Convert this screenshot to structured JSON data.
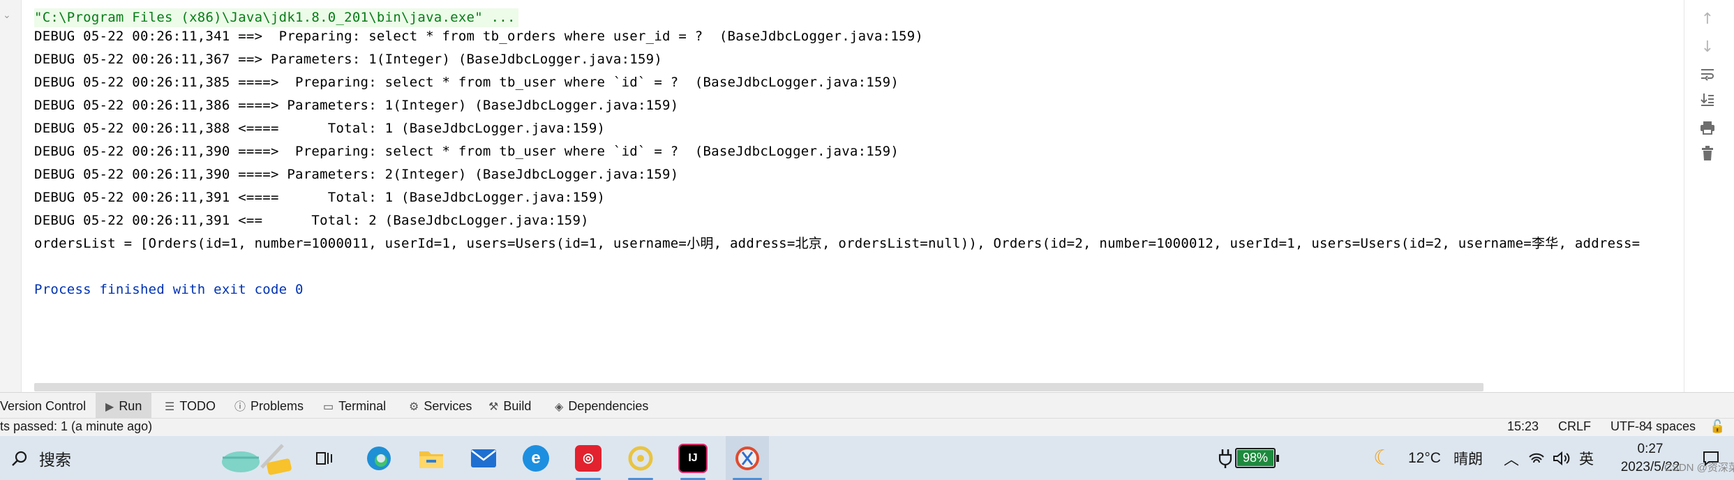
{
  "console": {
    "lines": [
      "\"C:\\Program Files (x86)\\Java\\jdk1.8.0_201\\bin\\java.exe\" ...",
      "DEBUG 05-22 00:26:11,341 ==>  Preparing: select * from tb_orders where user_id = ?  (BaseJdbcLogger.java:159)",
      "DEBUG 05-22 00:26:11,367 ==> Parameters: 1(Integer) (BaseJdbcLogger.java:159)",
      "DEBUG 05-22 00:26:11,385 ====>  Preparing: select * from tb_user where `id` = ?  (BaseJdbcLogger.java:159)",
      "DEBUG 05-22 00:26:11,386 ====> Parameters: 1(Integer) (BaseJdbcLogger.java:159)",
      "DEBUG 05-22 00:26:11,388 <====      Total: 1 (BaseJdbcLogger.java:159)",
      "DEBUG 05-22 00:26:11,390 ====>  Preparing: select * from tb_user where `id` = ?  (BaseJdbcLogger.java:159)",
      "DEBUG 05-22 00:26:11,390 ====> Parameters: 2(Integer) (BaseJdbcLogger.java:159)",
      "DEBUG 05-22 00:26:11,391 <====      Total: 1 (BaseJdbcLogger.java:159)",
      "DEBUG 05-22 00:26:11,391 <==      Total: 2 (BaseJdbcLogger.java:159)",
      "ordersList = [Orders(id=1, number=1000011, userId=1, users=Users(id=1, username=小明, address=北京, ordersList=null)), Orders(id=2, number=1000012, userId=1, users=Users(id=2, username=李华, address=",
      "",
      "Process finished with exit code 0"
    ]
  },
  "toolwindow_tabs": [
    {
      "label": "Version Control",
      "icon": "none"
    },
    {
      "label": "Run",
      "icon": "run-icon"
    },
    {
      "label": "TODO",
      "icon": "list-icon"
    },
    {
      "label": "Problems",
      "icon": "info-icon"
    },
    {
      "label": "Terminal",
      "icon": "terminal-icon"
    },
    {
      "label": "Services",
      "icon": "services-icon"
    },
    {
      "label": "Build",
      "icon": "hammer-icon"
    },
    {
      "label": "Dependencies",
      "icon": "layers-icon"
    }
  ],
  "statusbar": {
    "message": "ts passed: 1 (a minute ago)",
    "position": "15:23",
    "line_ending": "CRLF",
    "encoding": "UTF-8",
    "indent": "4 spaces"
  },
  "taskbar": {
    "search_label": "搜索",
    "battery": "98%",
    "temperature": "12°C",
    "weather": "晴朗",
    "ime": "英",
    "time": "0:27",
    "date": "2023/5/22",
    "watermark": "CSDN @资深菜鸟"
  },
  "colors": {
    "cmd_text": "#067d17",
    "cmd_bg": "#edfbe9",
    "exit_text": "#0033b3",
    "battery_bg": "#1e8a3e",
    "taskbar_bg": "#dde6ef"
  }
}
